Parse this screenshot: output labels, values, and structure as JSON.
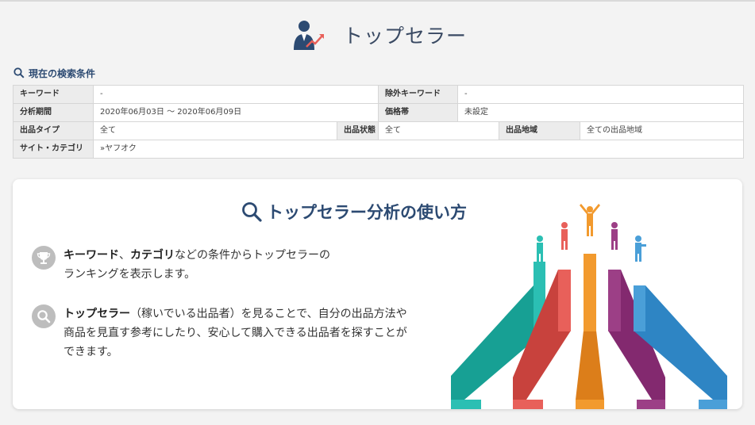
{
  "header": {
    "title": "トップセラー",
    "icon": "seller-growth-icon"
  },
  "conditions": {
    "heading": "現在の検索条件",
    "rows": [
      {
        "label_keyword": "キーワード",
        "keyword": "-",
        "label_exclude": "除外キーワード",
        "exclude": "-"
      },
      {
        "label_period": "分析期間",
        "period": "2020年06月03日 〜 2020年06月09日",
        "label_price": "価格帯",
        "price": "未設定"
      },
      {
        "label_type": "出品タイプ",
        "type": "全て",
        "label_state": "出品状態",
        "state": "全て",
        "label_region": "出品地域",
        "region": "全ての出品地域"
      },
      {
        "label_site": "サイト・カテゴリ",
        "site": "»ヤフオク"
      }
    ]
  },
  "guide": {
    "title": "トップセラー分析の使い方",
    "point1": {
      "b1": "キーワード",
      "t1": "、",
      "b2": "カテゴリ",
      "t2": "などの条件からトップセラーの",
      "line2": "ランキングを表示します。"
    },
    "point2": {
      "b1": "トップセラー",
      "t1": "（稼いでいる出品者）を見ることで、自分の出品方法や",
      "line2": "商品を見直す参考にしたり、安心して購入できる出品者を探すことが",
      "line3": "できます。"
    }
  },
  "colors": {
    "accent": "#2c4a72",
    "teal": "#2bbfb3",
    "red": "#e8605a",
    "orange": "#f29a2e",
    "purple": "#9c3f86",
    "blue": "#4a9fd8"
  }
}
